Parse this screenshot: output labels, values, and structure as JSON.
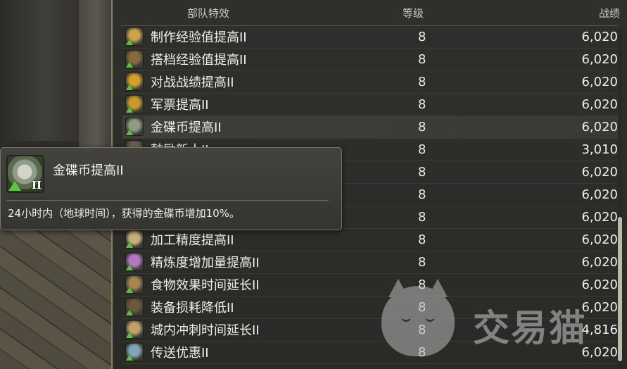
{
  "header": {
    "col_name": "部队特效",
    "col_level": "等级",
    "col_score": "战绩"
  },
  "rows": [
    {
      "name": "制作经验值提高II",
      "level": "8",
      "score": "6,020",
      "icon": "craft-icon",
      "color": "#c9a44a"
    },
    {
      "name": "搭档经验值提高II",
      "level": "8",
      "score": "6,020",
      "icon": "partner-icon",
      "color": "#8a6a3d"
    },
    {
      "name": "对战战绩提高II",
      "level": "8",
      "score": "6,020",
      "icon": "trophy-icon",
      "color": "#d1a02f"
    },
    {
      "name": "军票提高II",
      "level": "8",
      "score": "6,020",
      "icon": "seal-icon",
      "color": "#c99a2a"
    },
    {
      "name": "金碟币提高II",
      "level": "8",
      "score": "6,020",
      "icon": "mgp-coin-icon",
      "color": "#8f9c86"
    },
    {
      "name": "鼓励新人II",
      "level": "8",
      "score": "3,010",
      "icon": "newbie-icon",
      "color": "#6b6152"
    },
    {
      "name": "",
      "level": "8",
      "score": "6,020",
      "icon": "hidden-icon",
      "color": "#4a4a44"
    },
    {
      "name": "",
      "level": "8",
      "score": "6,020",
      "icon": "hidden-icon",
      "color": "#4a4a44"
    },
    {
      "name": "",
      "level": "8",
      "score": "6,020",
      "icon": "hidden-icon",
      "color": "#4a4a44"
    },
    {
      "name": "加工精度提高II",
      "level": "8",
      "score": "6,020",
      "icon": "control-icon",
      "color": "#c7b07a"
    },
    {
      "name": "精炼度增加量提高II",
      "level": "8",
      "score": "6,020",
      "icon": "spiritbond-icon",
      "color": "#b578c2"
    },
    {
      "name": "食物效果时间延长II",
      "level": "8",
      "score": "6,020",
      "icon": "food-icon",
      "color": "#a88452"
    },
    {
      "name": "装备损耗降低II",
      "level": "8",
      "score": "6,020",
      "icon": "gear-repair-icon",
      "color": "#6e5a3a"
    },
    {
      "name": "城内冲刺时间延长II",
      "level": "8",
      "score": "4,816",
      "icon": "sprint-icon",
      "color": "#c2a06e"
    },
    {
      "name": "传送优惠II",
      "level": "8",
      "score": "6,020",
      "icon": "teleport-icon",
      "color": "#7fa7b9"
    }
  ],
  "tooltip": {
    "title": "金碟币提高II",
    "rank": "II",
    "description": "24小时内（地球时间），获得的金碟币增加10%。"
  },
  "watermark": {
    "text": "交易猫"
  }
}
